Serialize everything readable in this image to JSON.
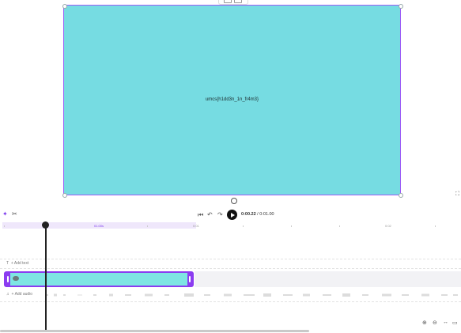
{
  "canvas": {
    "text": "umcs{h1dd3n_1n_fr4m3}",
    "background": "#76dce2",
    "selection_color": "#9b5cf6"
  },
  "playback": {
    "current_time": "0:00.22",
    "total_time": "0:01.00"
  },
  "ruler": {
    "labels": [
      "01.00s",
      "0:01",
      "0:02"
    ]
  },
  "tracks": {
    "text_label": "+ Add text",
    "audio_label": "+ Add audio",
    "clip_color": "#7ee5e3",
    "clip_border": "#8b3cf0"
  },
  "icons": [
    "sparkle-icon",
    "scissors-icon",
    "skip-back-icon",
    "undo-icon",
    "redo-icon",
    "play-icon",
    "rotate-icon",
    "fullscreen-icon",
    "text-icon",
    "eye-icon",
    "music-icon",
    "zoom-in-icon",
    "zoom-out-icon",
    "fit-icon",
    "captions-icon"
  ]
}
